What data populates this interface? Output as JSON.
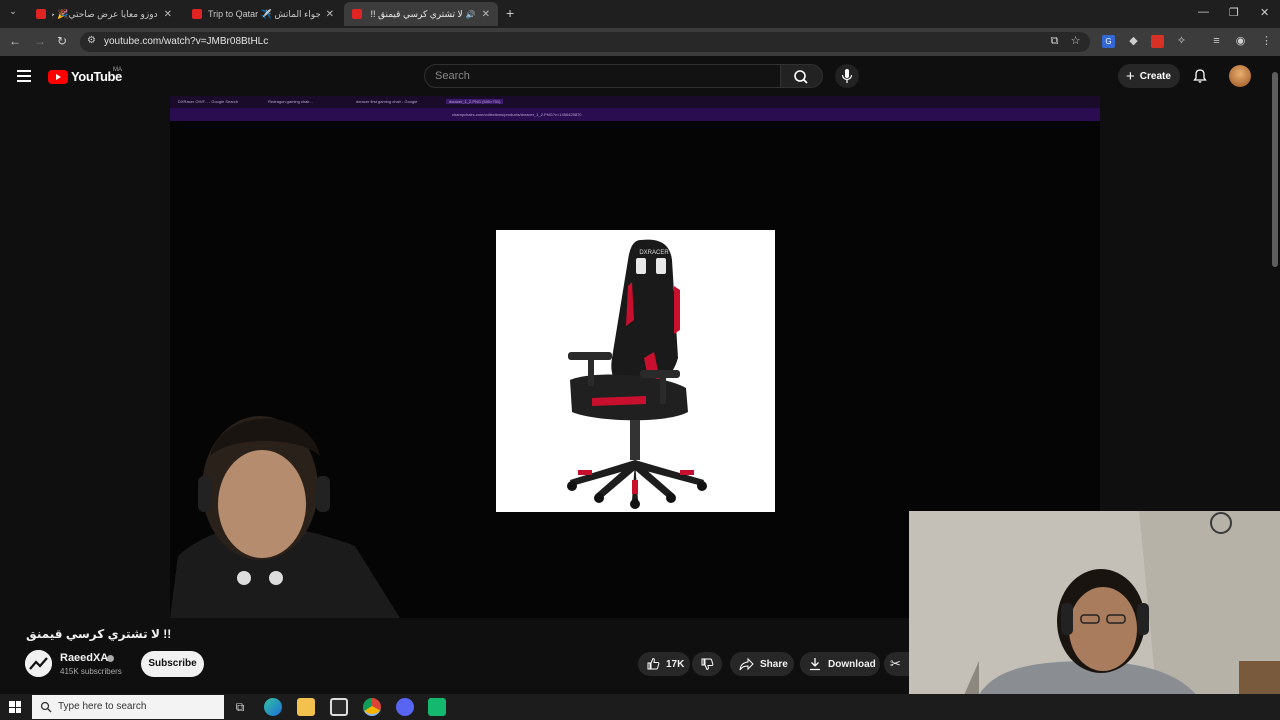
{
  "browser": {
    "tabs": [
      {
        "title": "دوزو معايا عرض صاحتي🎉 جب...",
        "active": false
      },
      {
        "title": "Trip to Qatar ✈️ أجواء الماتش 🇶🇦...",
        "active": false
      },
      {
        "title": "لا تشتري كرسي قيمنق !! - You...",
        "active": true
      }
    ],
    "new_tab_symbol": "+",
    "url": "youtube.com/watch?v=JMBr08BtHLc"
  },
  "youtube": {
    "logo_text": "YouTube",
    "country_code": "MA",
    "search_placeholder": "Search",
    "create_label": "Create"
  },
  "video": {
    "inner_browser": {
      "tabs": [
        "DXRacer OH/F... - Google Search",
        "Redragon gaming chair...",
        "dxracer first gaming chair - Google",
        "dxracer_1_2.PNG (640×701)"
      ],
      "url": "champchairs.com/collections/products/dxracer_1_2.PNG?v=1456425870"
    },
    "chair_brand": "DXRACER"
  },
  "meta": {
    "title": "!! لا تشتري كرسي قيمنق",
    "channel_name": "RaeedXA",
    "subscribers": "415K subscribers",
    "subscribe_label": "Subscribe",
    "like_count": "17K",
    "share_label": "Share",
    "download_label": "Download"
  },
  "taskbar": {
    "search_placeholder": "Type here to search"
  },
  "colors": {
    "youtube_red": "#ff0000",
    "background": "#0f0f0f",
    "chair_accent": "#c8102e"
  }
}
